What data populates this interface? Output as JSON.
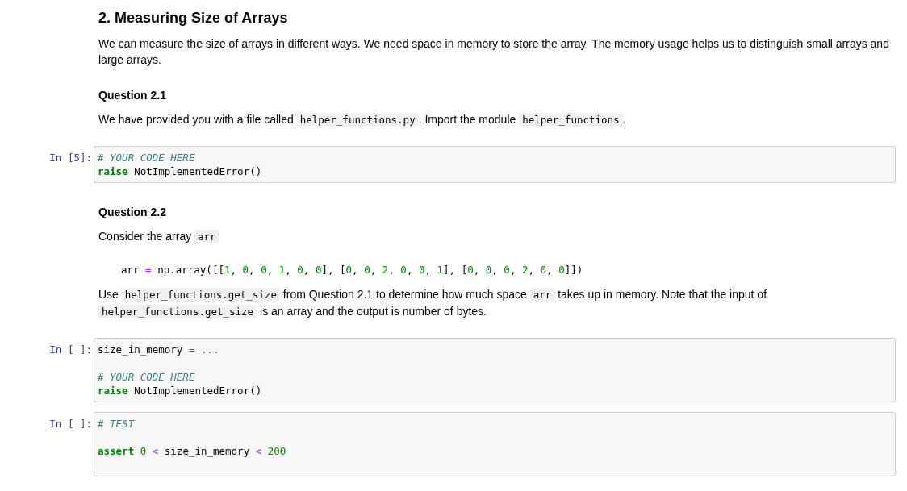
{
  "items": [
    {
      "kind": "heading",
      "text": "2. Measuring Size of Arrays"
    },
    {
      "kind": "paragraph",
      "segments": [
        {
          "kind": "text",
          "text": "We can measure the size of arrays in different ways. We need space in memory to store the array. The memory usage helps us to distinguish small arrays and large arrays."
        }
      ]
    },
    {
      "kind": "subheading",
      "text": "Question 2.1"
    },
    {
      "kind": "paragraph",
      "segments": [
        {
          "kind": "text",
          "text": "We have provided you with a file called"
        },
        {
          "kind": "code",
          "text": "helper_functions.py"
        },
        {
          "kind": "text",
          "text": ". Import the module"
        },
        {
          "kind": "code",
          "text": "helper_functions"
        },
        {
          "kind": "text",
          "text": "."
        }
      ]
    },
    {
      "kind": "code_cell",
      "prompt": "In [5]:",
      "blocks": [
        [
          [
            {
              "kind": "comment",
              "t": "# YOUR CODE HERE"
            }
          ],
          [
            {
              "kind": "keyword",
              "t": "raise"
            },
            {
              "kind": "plain",
              "t": " NotImplementedError()"
            }
          ]
        ]
      ]
    },
    {
      "kind": "subheading",
      "text": "Question 2.2"
    },
    {
      "kind": "paragraph",
      "segments": [
        {
          "kind": "text",
          "text": "Consider the array"
        },
        {
          "kind": "code",
          "text": "arr"
        }
      ]
    },
    {
      "kind": "code_block",
      "lines": [
        [
          {
            "kind": "plain",
            "t": "arr "
          },
          {
            "kind": "operator",
            "t": "="
          },
          {
            "kind": "plain",
            "t": " np.array([["
          },
          {
            "kind": "number",
            "t": "1"
          },
          {
            "kind": "plain",
            "t": ", "
          },
          {
            "kind": "number",
            "t": "0"
          },
          {
            "kind": "plain",
            "t": ", "
          },
          {
            "kind": "number",
            "t": "0"
          },
          {
            "kind": "plain",
            "t": ", "
          },
          {
            "kind": "number",
            "t": "1"
          },
          {
            "kind": "plain",
            "t": ", "
          },
          {
            "kind": "number",
            "t": "0"
          },
          {
            "kind": "plain",
            "t": ", "
          },
          {
            "kind": "number",
            "t": "0"
          },
          {
            "kind": "plain",
            "t": "], ["
          },
          {
            "kind": "number",
            "t": "0"
          },
          {
            "kind": "plain",
            "t": ", "
          },
          {
            "kind": "number",
            "t": "0"
          },
          {
            "kind": "plain",
            "t": ", "
          },
          {
            "kind": "number",
            "t": "2"
          },
          {
            "kind": "plain",
            "t": ", "
          },
          {
            "kind": "number",
            "t": "0"
          },
          {
            "kind": "plain",
            "t": ", "
          },
          {
            "kind": "number",
            "t": "0"
          },
          {
            "kind": "plain",
            "t": ", "
          },
          {
            "kind": "number",
            "t": "1"
          },
          {
            "kind": "plain",
            "t": "], ["
          },
          {
            "kind": "number",
            "t": "0"
          },
          {
            "kind": "plain",
            "t": ", "
          },
          {
            "kind": "number",
            "t": "0"
          },
          {
            "kind": "plain",
            "t": ", "
          },
          {
            "kind": "number",
            "t": "0"
          },
          {
            "kind": "plain",
            "t": ", "
          },
          {
            "kind": "number",
            "t": "2"
          },
          {
            "kind": "plain",
            "t": ", "
          },
          {
            "kind": "number",
            "t": "0"
          },
          {
            "kind": "plain",
            "t": ", "
          },
          {
            "kind": "number",
            "t": "0"
          },
          {
            "kind": "plain",
            "t": "]])"
          }
        ]
      ]
    },
    {
      "kind": "paragraph",
      "segments": [
        {
          "kind": "text",
          "text": "Use"
        },
        {
          "kind": "code",
          "text": "helper_functions.get_size"
        },
        {
          "kind": "text",
          "text": "from Question 2.1 to determine how much space"
        },
        {
          "kind": "code",
          "text": "arr"
        },
        {
          "kind": "text",
          "text": "takes up in memory. Note that the input of"
        },
        {
          "kind": "break"
        },
        {
          "kind": "code",
          "text": "helper_functions.get_size"
        },
        {
          "kind": "text",
          "text": "is an array and the output is number of bytes."
        }
      ]
    },
    {
      "kind": "code_cell",
      "prompt": "In [ ]:",
      "blocks": [
        [
          [
            {
              "kind": "plain",
              "t": "size_in_memory "
            },
            {
              "kind": "operator",
              "t": "= ..."
            }
          ]
        ],
        [
          [
            {
              "kind": "comment",
              "t": "# YOUR CODE HERE"
            }
          ],
          [
            {
              "kind": "keyword",
              "t": "raise"
            },
            {
              "kind": "plain",
              "t": " NotImplementedError()"
            }
          ]
        ]
      ]
    },
    {
      "kind": "code_cell",
      "prompt": "In [ ]:",
      "blocks": [
        [
          [
            {
              "kind": "comment",
              "t": "# TEST"
            }
          ]
        ],
        [
          [
            {
              "kind": "keyword",
              "t": "assert"
            },
            {
              "kind": "number",
              "t": " 0"
            },
            {
              "kind": "operator",
              "t": " <"
            },
            {
              "kind": "plain",
              "t": " size_in_memory "
            },
            {
              "kind": "operator",
              "t": "<"
            },
            {
              "kind": "number",
              "t": " 200"
            }
          ]
        ]
      ]
    }
  ]
}
